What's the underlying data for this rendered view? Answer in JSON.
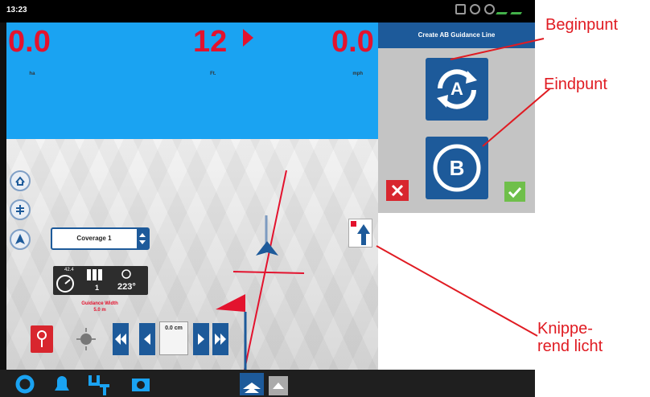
{
  "status": {
    "time": "13:23"
  },
  "readouts": {
    "left_value": "0.0",
    "left_unit": "ha",
    "center_value": "12",
    "center_unit": "Ft.",
    "right_value": "0.0",
    "right_unit": "mph"
  },
  "panel": {
    "title": "Create AB Guidance Line",
    "button_a_label": "A",
    "button_b_label": "B"
  },
  "left": {
    "coverage_value": "Coverage 1",
    "guidance_width_label": "Guidance Width",
    "guidance_width_value": "5.0 m",
    "stat_speed": "42.4",
    "stat_sections": "1",
    "stat_heading": "223°"
  },
  "nudge": {
    "value": "0.0",
    "unit": "cm"
  },
  "annotations": {
    "begin": "Beginpunt",
    "end": "Eindpunt",
    "light_line1": "Knippe-",
    "light_line2": "rend licht"
  },
  "colors": {
    "sky": "#1aa3f2",
    "brand_blue": "#1d5a9a",
    "readout_red": "#e3132e",
    "annotation_red": "#e01b22",
    "ok_green": "#6fbf4a"
  }
}
